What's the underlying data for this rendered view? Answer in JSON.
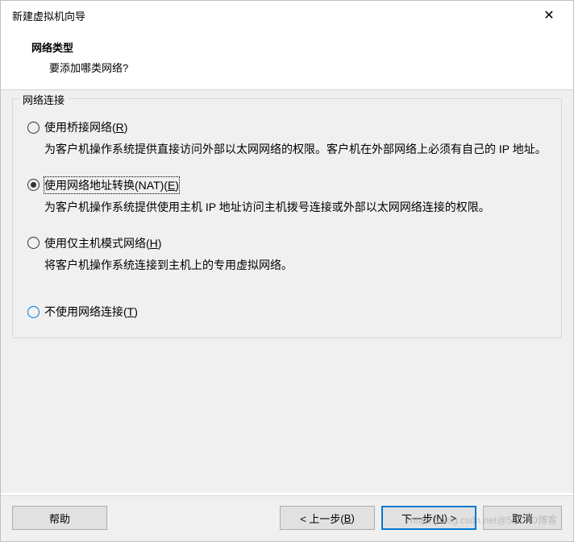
{
  "window": {
    "title": "新建虚拟机向导"
  },
  "header": {
    "title": "网络类型",
    "subtitle": "要添加哪类网络?"
  },
  "fieldset": {
    "legend": "网络连接"
  },
  "options": {
    "bridged": {
      "label_pre": "使用桥接网络(",
      "label_u": "R",
      "label_post": ")",
      "desc": "为客户机操作系统提供直接访问外部以太网网络的权限。客户机在外部网络上必须有自己的 IP 地址。"
    },
    "nat": {
      "label_pre": "使用网络地址转换(NAT)(",
      "label_u": "E",
      "label_post": ")",
      "desc": "为客户机操作系统提供使用主机 IP 地址访问主机拨号连接或外部以太网网络连接的权限。"
    },
    "hostonly": {
      "label_pre": "使用仅主机模式网络(",
      "label_u": "H",
      "label_post": ")",
      "desc": "将客户机操作系统连接到主机上的专用虚拟网络。"
    },
    "none": {
      "label_pre": "不使用网络连接(",
      "label_u": "T",
      "label_post": ")"
    }
  },
  "buttons": {
    "help": "帮助",
    "back_pre": "< 上一步(",
    "back_u": "B",
    "back_post": ")",
    "next_pre": "下一步(",
    "next_u": "N",
    "next_post": ") >",
    "cancel": "取消"
  },
  "watermark": "https://blog.csdn.net@51CTO博客"
}
